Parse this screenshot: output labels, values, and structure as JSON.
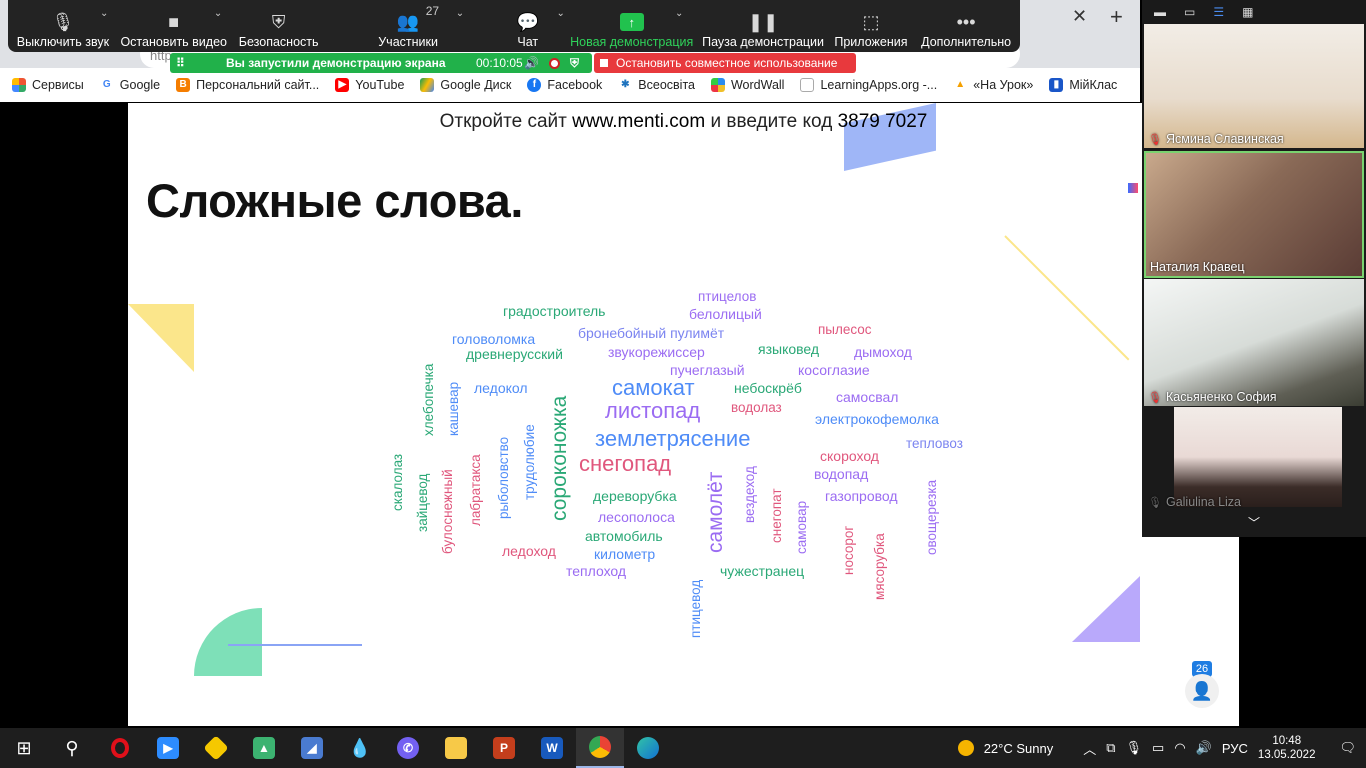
{
  "zoom_toolbar": {
    "mute": "Выключить звук",
    "stop_video": "Остановить видео",
    "security": "Безопасность",
    "participants": "Участники",
    "participants_count": "27",
    "chat": "Чат",
    "new_share": "Новая демонстрация",
    "pause_share": "Пауза демонстрации",
    "apps": "Приложения",
    "more": "Дополнительно"
  },
  "share_status": {
    "text": "Вы запустили демонстрацию экрана",
    "timer": "00:10:05",
    "stop": "Остановить совместное использование"
  },
  "browser": {
    "url_fragment": "http",
    "bookmarks": [
      "Сервисы",
      "Google",
      "Персональний сайт...",
      "YouTube",
      "Google Диск",
      "Facebook",
      "Всеосвіта",
      "WordWall",
      "LearningApps.org -...",
      "«На Урок»",
      "МійКлас"
    ]
  },
  "slide": {
    "header_prefix": "Откройте сайт ",
    "header_site": "www.menti.com",
    "header_mid": " и введите код ",
    "header_code": "3879 7027",
    "title": "Сложные слова.",
    "participants_count": "26"
  },
  "word_cloud": {
    "words": [
      "градостроитель",
      "птицелов",
      "белолицый",
      "пылесос",
      "головоломка",
      "бронебойный пулимёт",
      "древнерусский",
      "звукорежиссер",
      "языковед",
      "дымоход",
      "пучеглазый",
      "косоглазие",
      "самокат",
      "небоскрёб",
      "ледокол",
      "самосвал",
      "листопад",
      "водолаз",
      "электрокофемолка",
      "землетрясение",
      "тепловоз",
      "снегопад",
      "скороход",
      "водопад",
      "дереворубка",
      "газопровод",
      "лесополоса",
      "автомобиль",
      "километр",
      "ледоход",
      "теплоход",
      "чужестранец",
      "хлебопечка",
      "кашевар",
      "скалолаз",
      "зайцевод",
      "булоснежный",
      "лабратакса",
      "рыболовство",
      "трудолюбие",
      "сороконожка",
      "самолёт",
      "вездеход",
      "снегопат",
      "самовар",
      "носорог",
      "мясорубка",
      "овощерезка",
      "птицевод"
    ]
  },
  "gallery": {
    "participants": [
      "Ясмина Славинская",
      "Наталия Кравец",
      "Касьяненко София",
      "Galiulina Liza"
    ]
  },
  "taskbar": {
    "weather": "22°C  Sunny",
    "lang": "РУС",
    "time": "10:48",
    "date": "13.05.2022"
  }
}
